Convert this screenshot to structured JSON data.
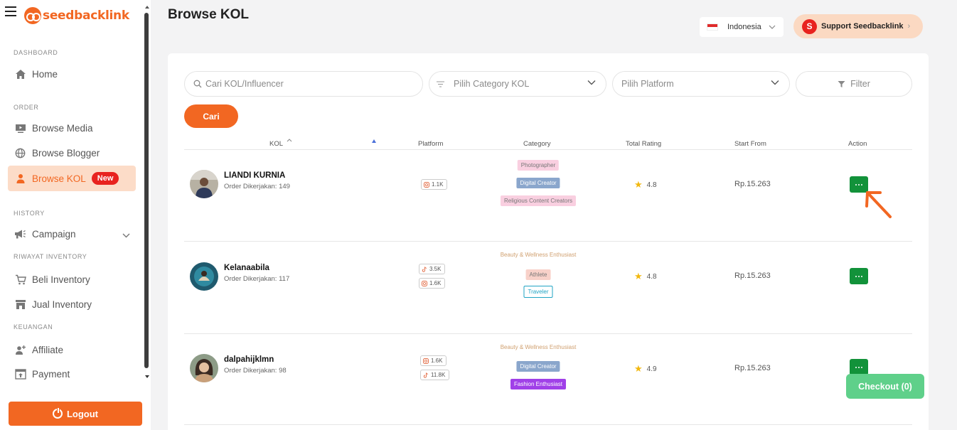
{
  "brand": {
    "name": "seedbacklink",
    "color": "#f26722"
  },
  "sidebar": {
    "sections": {
      "dashboard": "DASHBOARD",
      "order": "ORDER",
      "history": "HISTORY",
      "riwayat": "RIWAYAT INVENTORY",
      "keuangan": "KEUANGAN"
    },
    "items": {
      "home": "Home",
      "browse_media": "Browse Media",
      "browse_blogger": "Browse Blogger",
      "browse_kol": "Browse KOL",
      "campaign": "Campaign",
      "beli_inventory": "Beli Inventory",
      "jual_inventory": "Jual Inventory",
      "affiliate": "Affiliate",
      "payment": "Payment"
    },
    "new_badge": "New",
    "logout": "Logout"
  },
  "header": {
    "title": "Browse KOL",
    "language": "Indonesia",
    "support_logo": "S",
    "support": "Support Seedbacklink",
    "support_chevron": "›"
  },
  "filters": {
    "search_placeholder": "Cari KOL/Influencer",
    "category_placeholder": "Pilih Category KOL",
    "platform_placeholder": "Pilih Platform",
    "filter_label": "Filter",
    "search_button": "Cari"
  },
  "table": {
    "headers": {
      "kol": "KOL",
      "platform": "Platform",
      "category": "Category",
      "rating": "Total Rating",
      "start": "Start From",
      "action": "Action"
    },
    "rows": [
      {
        "name": "LIANDI KURNIA",
        "order": "Order Dikerjakan: 149",
        "platforms": [
          {
            "icon": "instagram-icon",
            "count": "1.1K"
          }
        ],
        "categories": [
          "Photographer",
          "Digital Creator",
          "Religious Content Creators"
        ],
        "rating": "4.8",
        "price": "Rp.15.263"
      },
      {
        "name": "Kelanaabila",
        "order": "Order Dikerjakan: 117",
        "platforms": [
          {
            "icon": "tiktok-icon",
            "count": "3.5K"
          },
          {
            "icon": "instagram-icon",
            "count": "1.6K"
          }
        ],
        "categories": [
          "Beauty & Wellness Enthusiast",
          "Athlete",
          "Traveler"
        ],
        "rating": "4.8",
        "price": "Rp.15.263"
      },
      {
        "name": "dalpahijklmn",
        "order": "Order Dikerjakan: 98",
        "platforms": [
          {
            "icon": "instagram-icon",
            "count": "1.6K"
          },
          {
            "icon": "tiktok-icon",
            "count": "11.8K"
          }
        ],
        "categories": [
          "Beauty & Wellness Enthusiast",
          "Digital Creator",
          "Fashion Enthusiast"
        ],
        "rating": "4.9",
        "price": "Rp.15.263"
      }
    ]
  },
  "checkout": "Checkout (0)",
  "colors": {
    "accent": "#f26722",
    "action_green": "#12923a",
    "checkout_green": "#5fd08a"
  }
}
